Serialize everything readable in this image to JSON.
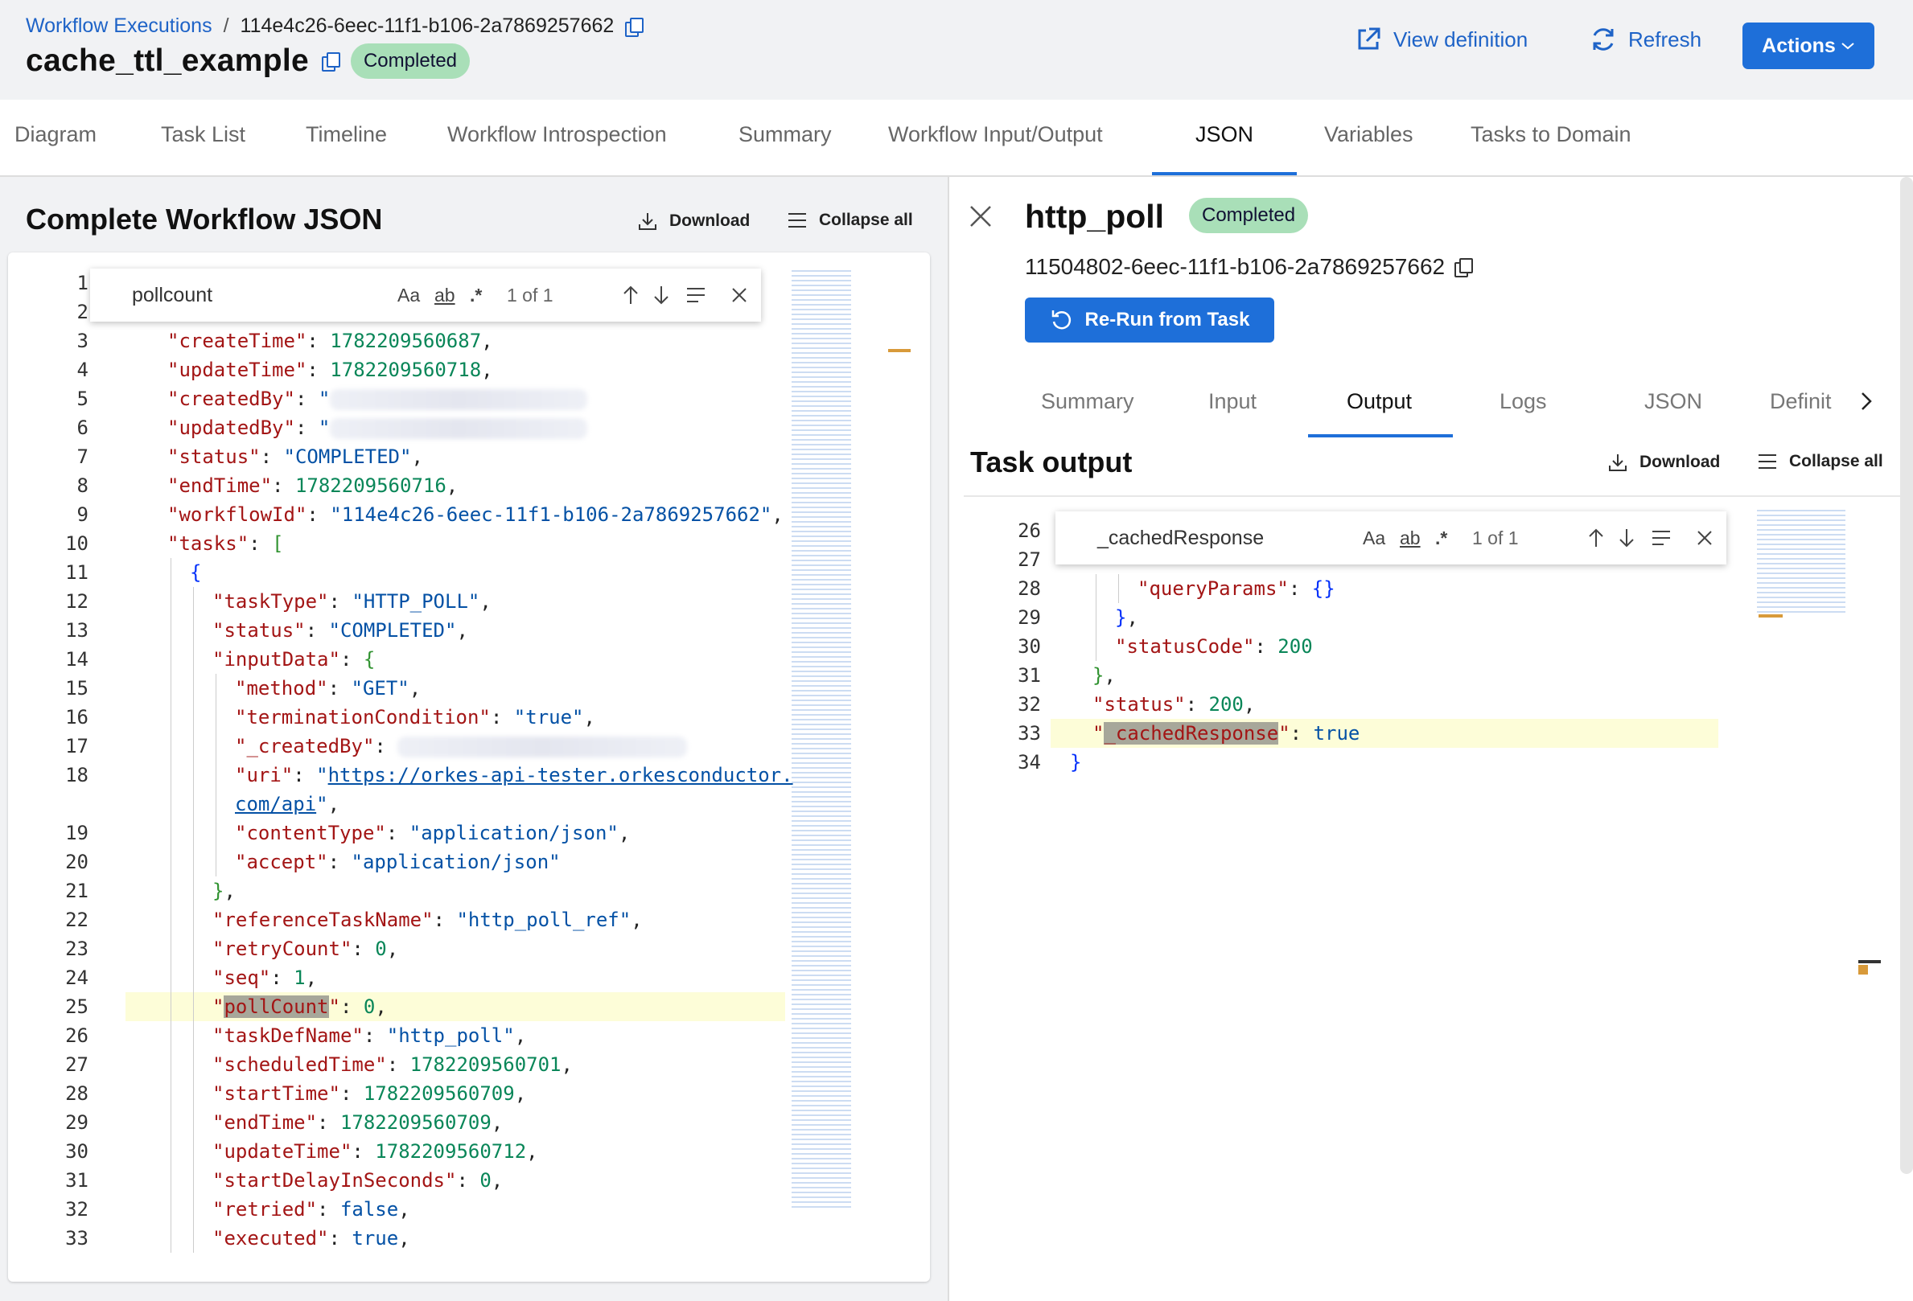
{
  "breadcrumb": {
    "link": "Workflow Executions",
    "separator": "/",
    "current": "114e4c26-6eec-11f1-b106-2a7869257662"
  },
  "workflow": {
    "name": "cache_ttl_example",
    "status": "Completed"
  },
  "header_buttons": {
    "view_definition": "View definition",
    "refresh": "Refresh",
    "actions": "Actions"
  },
  "tabs": [
    "Diagram",
    "Task List",
    "Timeline",
    "Workflow Introspection",
    "Summary",
    "Workflow Input/Output",
    "JSON",
    "Variables",
    "Tasks to Domain"
  ],
  "active_tab": "JSON",
  "left_panel": {
    "title": "Complete Workflow JSON",
    "download": "Download",
    "collapse_all": "Collapse all",
    "find": {
      "query": "pollcount",
      "case": "Aa",
      "word": "ab",
      "regex": ".*",
      "count": "1 of 1"
    },
    "lines": [
      {
        "n": "1",
        "indent": 0,
        "tokens": []
      },
      {
        "n": "2",
        "indent": 0,
        "tokens": []
      },
      {
        "n": "3",
        "indent": 1,
        "tokens": [
          [
            "k",
            "\"createTime\""
          ],
          [
            "p",
            ": "
          ],
          [
            "n",
            "1782209560687"
          ],
          [
            "p",
            ","
          ]
        ]
      },
      {
        "n": "4",
        "indent": 1,
        "tokens": [
          [
            "k",
            "\"updateTime\""
          ],
          [
            "p",
            ": "
          ],
          [
            "n",
            "1782209560718"
          ],
          [
            "p",
            ","
          ]
        ]
      },
      {
        "n": "5",
        "indent": 1,
        "tokens": [
          [
            "k",
            "\"createdBy\""
          ],
          [
            "p",
            ": "
          ],
          [
            "s",
            "\""
          ],
          [
            "blur",
            "320"
          ]
        ]
      },
      {
        "n": "6",
        "indent": 1,
        "tokens": [
          [
            "k",
            "\"updatedBy\""
          ],
          [
            "p",
            ": "
          ],
          [
            "s",
            "\""
          ],
          [
            "blur",
            "320"
          ]
        ]
      },
      {
        "n": "7",
        "indent": 1,
        "tokens": [
          [
            "k",
            "\"status\""
          ],
          [
            "p",
            ": "
          ],
          [
            "s",
            "\"COMPLETED\""
          ],
          [
            "p",
            ","
          ]
        ]
      },
      {
        "n": "8",
        "indent": 1,
        "tokens": [
          [
            "k",
            "\"endTime\""
          ],
          [
            "p",
            ": "
          ],
          [
            "n",
            "1782209560716"
          ],
          [
            "p",
            ","
          ]
        ]
      },
      {
        "n": "9",
        "indent": 1,
        "tokens": [
          [
            "k",
            "\"workflowId\""
          ],
          [
            "p",
            ": "
          ],
          [
            "s",
            "\"114e4c26-6eec-11f1-b106-2a7869257662\""
          ],
          [
            "p",
            ","
          ]
        ]
      },
      {
        "n": "10",
        "indent": 1,
        "tokens": [
          [
            "k",
            "\"tasks\""
          ],
          [
            "p",
            ": "
          ],
          [
            "br",
            "["
          ]
        ]
      },
      {
        "n": "11",
        "indent": 2,
        "tokens": [
          [
            "br2",
            "{"
          ]
        ]
      },
      {
        "n": "12",
        "indent": 3,
        "tokens": [
          [
            "k",
            "\"taskType\""
          ],
          [
            "p",
            ": "
          ],
          [
            "s",
            "\"HTTP_POLL\""
          ],
          [
            "p",
            ","
          ]
        ]
      },
      {
        "n": "13",
        "indent": 3,
        "tokens": [
          [
            "k",
            "\"status\""
          ],
          [
            "p",
            ": "
          ],
          [
            "s",
            "\"COMPLETED\""
          ],
          [
            "p",
            ","
          ]
        ]
      },
      {
        "n": "14",
        "indent": 3,
        "tokens": [
          [
            "k",
            "\"inputData\""
          ],
          [
            "p",
            ": "
          ],
          [
            "br",
            "{"
          ]
        ]
      },
      {
        "n": "15",
        "indent": 4,
        "tokens": [
          [
            "k",
            "\"method\""
          ],
          [
            "p",
            ": "
          ],
          [
            "s",
            "\"GET\""
          ],
          [
            "p",
            ","
          ]
        ]
      },
      {
        "n": "16",
        "indent": 4,
        "tokens": [
          [
            "k",
            "\"terminationCondition\""
          ],
          [
            "p",
            ": "
          ],
          [
            "s",
            "\"true\""
          ],
          [
            "p",
            ","
          ]
        ]
      },
      {
        "n": "17",
        "indent": 4,
        "tokens": [
          [
            "k",
            "\"_createdBy\""
          ],
          [
            "p",
            ": "
          ],
          [
            "blur",
            "360"
          ]
        ]
      },
      {
        "n": "18",
        "indent": 4,
        "tokens": [
          [
            "k",
            "\"uri\""
          ],
          [
            "p",
            ": "
          ],
          [
            "s",
            "\""
          ],
          [
            "lnk",
            "https://orkes-api-tester.orkesconductor."
          ]
        ]
      },
      {
        "n": "",
        "indent": 4,
        "tokens": [
          [
            "lnk",
            "com/api"
          ],
          [
            "s",
            "\""
          ],
          [
            "p",
            ","
          ]
        ]
      },
      {
        "n": "19",
        "indent": 4,
        "tokens": [
          [
            "k",
            "\"contentType\""
          ],
          [
            "p",
            ": "
          ],
          [
            "s",
            "\"application/json\""
          ],
          [
            "p",
            ","
          ]
        ]
      },
      {
        "n": "20",
        "indent": 4,
        "tokens": [
          [
            "k",
            "\"accept\""
          ],
          [
            "p",
            ": "
          ],
          [
            "s",
            "\"application/json\""
          ]
        ]
      },
      {
        "n": "21",
        "indent": 3,
        "tokens": [
          [
            "br",
            "}"
          ],
          [
            "p",
            ","
          ]
        ]
      },
      {
        "n": "22",
        "indent": 3,
        "tokens": [
          [
            "k",
            "\"referenceTaskName\""
          ],
          [
            "p",
            ": "
          ],
          [
            "s",
            "\"http_poll_ref\""
          ],
          [
            "p",
            ","
          ]
        ]
      },
      {
        "n": "23",
        "indent": 3,
        "tokens": [
          [
            "k",
            "\"retryCount\""
          ],
          [
            "p",
            ": "
          ],
          [
            "n",
            "0"
          ],
          [
            "p",
            ","
          ]
        ]
      },
      {
        "n": "24",
        "indent": 3,
        "tokens": [
          [
            "k",
            "\"seq\""
          ],
          [
            "p",
            ": "
          ],
          [
            "n",
            "1"
          ],
          [
            "p",
            ","
          ]
        ]
      },
      {
        "n": "25",
        "indent": 3,
        "hl": true,
        "tokens": [
          [
            "k",
            "\""
          ],
          [
            "khl",
            "pollCount"
          ],
          [
            "k",
            "\""
          ],
          [
            "p",
            ": "
          ],
          [
            "n",
            "0"
          ],
          [
            "p",
            ","
          ]
        ]
      },
      {
        "n": "26",
        "indent": 3,
        "tokens": [
          [
            "k",
            "\"taskDefName\""
          ],
          [
            "p",
            ": "
          ],
          [
            "s",
            "\"http_poll\""
          ],
          [
            "p",
            ","
          ]
        ]
      },
      {
        "n": "27",
        "indent": 3,
        "tokens": [
          [
            "k",
            "\"scheduledTime\""
          ],
          [
            "p",
            ": "
          ],
          [
            "n",
            "1782209560701"
          ],
          [
            "p",
            ","
          ]
        ]
      },
      {
        "n": "28",
        "indent": 3,
        "tokens": [
          [
            "k",
            "\"startTime\""
          ],
          [
            "p",
            ": "
          ],
          [
            "n",
            "1782209560709"
          ],
          [
            "p",
            ","
          ]
        ]
      },
      {
        "n": "29",
        "indent": 3,
        "tokens": [
          [
            "k",
            "\"endTime\""
          ],
          [
            "p",
            ": "
          ],
          [
            "n",
            "1782209560709"
          ],
          [
            "p",
            ","
          ]
        ]
      },
      {
        "n": "30",
        "indent": 3,
        "tokens": [
          [
            "k",
            "\"updateTime\""
          ],
          [
            "p",
            ": "
          ],
          [
            "n",
            "1782209560712"
          ],
          [
            "p",
            ","
          ]
        ]
      },
      {
        "n": "31",
        "indent": 3,
        "tokens": [
          [
            "k",
            "\"startDelayInSeconds\""
          ],
          [
            "p",
            ": "
          ],
          [
            "n",
            "0"
          ],
          [
            "p",
            ","
          ]
        ]
      },
      {
        "n": "32",
        "indent": 3,
        "tokens": [
          [
            "k",
            "\"retried\""
          ],
          [
            "p",
            ": "
          ],
          [
            "b",
            "false"
          ],
          [
            "p",
            ","
          ]
        ]
      },
      {
        "n": "33",
        "indent": 3,
        "tokens": [
          [
            "k",
            "\"executed\""
          ],
          [
            "p",
            ": "
          ],
          [
            "b",
            "true"
          ],
          [
            "p",
            ","
          ]
        ]
      }
    ]
  },
  "task": {
    "name": "http_poll",
    "status": "Completed",
    "id": "11504802-6eec-11f1-b106-2a7869257662",
    "rerun": "Re-Run from Task",
    "tabs": [
      "Summary",
      "Input",
      "Output",
      "Logs",
      "JSON",
      "Definit"
    ],
    "active_tab": "Output",
    "output_title": "Task output",
    "download": "Download",
    "collapse_all": "Collapse all",
    "find": {
      "query": "_cachedResponse",
      "case": "Aa",
      "word": "ab",
      "regex": ".*",
      "count": "1 of 1"
    },
    "lines": [
      {
        "n": "26",
        "indent": 0,
        "tokens": []
      },
      {
        "n": "27",
        "indent": 0,
        "tokens": []
      },
      {
        "n": "28",
        "indent": 3,
        "tokens": [
          [
            "k",
            "\"queryParams\""
          ],
          [
            "p",
            ": "
          ],
          [
            "br2",
            "{}"
          ]
        ]
      },
      {
        "n": "29",
        "indent": 2,
        "tokens": [
          [
            "br2",
            "}"
          ],
          [
            "p",
            ","
          ]
        ]
      },
      {
        "n": "30",
        "indent": 2,
        "tokens": [
          [
            "k",
            "\"statusCode\""
          ],
          [
            "p",
            ": "
          ],
          [
            "n",
            "200"
          ]
        ]
      },
      {
        "n": "31",
        "indent": 1,
        "tokens": [
          [
            "br",
            "}"
          ],
          [
            "p",
            ","
          ]
        ]
      },
      {
        "n": "32",
        "indent": 1,
        "tokens": [
          [
            "k",
            "\"status\""
          ],
          [
            "p",
            ": "
          ],
          [
            "n",
            "200"
          ],
          [
            "p",
            ","
          ]
        ]
      },
      {
        "n": "33",
        "indent": 1,
        "hl": true,
        "tokens": [
          [
            "k",
            "\""
          ],
          [
            "khl",
            "_cachedResponse"
          ],
          [
            "k",
            "\""
          ],
          [
            "p",
            ": "
          ],
          [
            "b",
            "true"
          ]
        ]
      },
      {
        "n": "34",
        "indent": 0,
        "tokens": [
          [
            "br2",
            "}"
          ]
        ]
      }
    ]
  }
}
